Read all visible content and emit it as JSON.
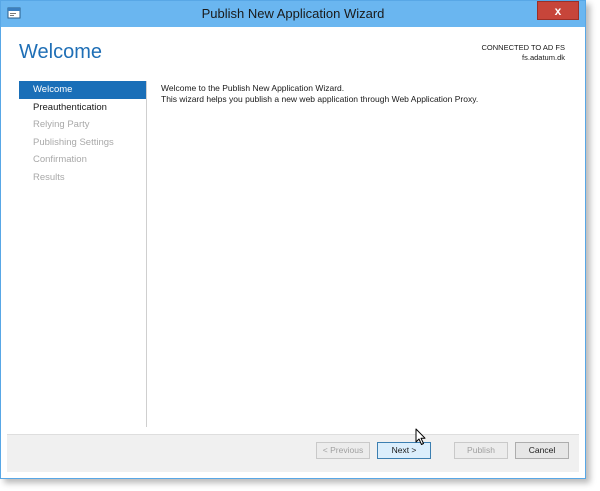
{
  "window": {
    "title": "Publish New Application Wizard",
    "close_glyph": "x"
  },
  "page": {
    "heading": "Welcome",
    "connection_line1": "CONNECTED TO AD FS",
    "connection_line2": "fs.adatum.dk"
  },
  "sidebar": {
    "items": [
      {
        "label": "Welcome",
        "state": "active"
      },
      {
        "label": "Preauthentication",
        "state": "enabled"
      },
      {
        "label": "Relying Party",
        "state": "disabled"
      },
      {
        "label": "Publishing Settings",
        "state": "disabled"
      },
      {
        "label": "Confirmation",
        "state": "disabled"
      },
      {
        "label": "Results",
        "state": "disabled"
      }
    ]
  },
  "main": {
    "line1": "Welcome to the Publish New Application Wizard.",
    "line2": "This wizard helps you publish a new web application through Web Application Proxy."
  },
  "footer": {
    "previous_label": "< Previous",
    "next_label": "Next >",
    "publish_label": "Publish",
    "cancel_label": "Cancel"
  },
  "colors": {
    "titlebar": "#6ab6f0",
    "accent": "#1a6fb8",
    "heading": "#1f6fb6",
    "close": "#c7453a"
  }
}
